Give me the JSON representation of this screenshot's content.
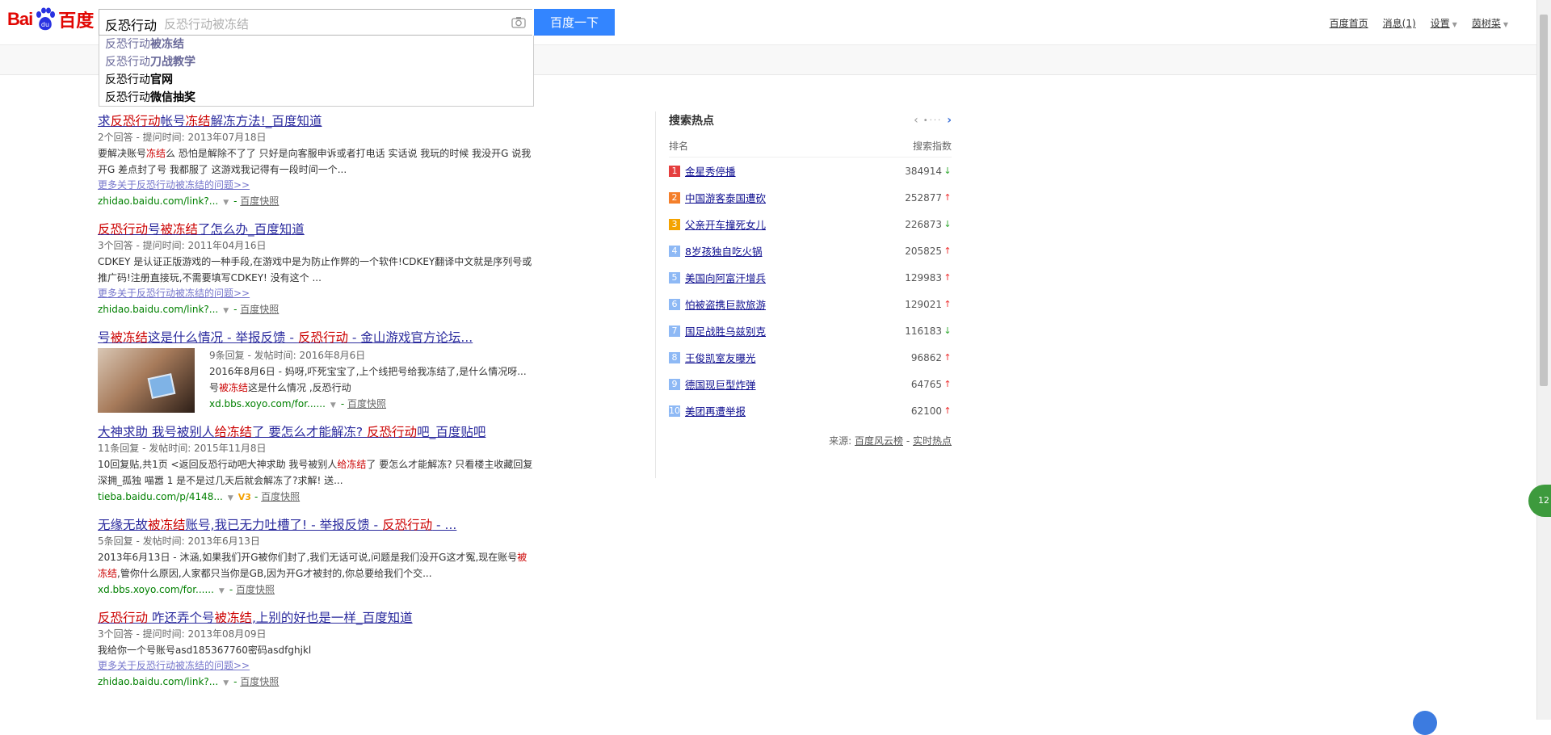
{
  "logo": {
    "bai": "Bai",
    "du": "百度"
  },
  "search": {
    "query": "反恐行动",
    "hint": "反恐行动被冻结",
    "button": "百度一下"
  },
  "suggestions": [
    {
      "prefix": "反恐行动",
      "suffix": "被冻结",
      "muted": true
    },
    {
      "prefix": "反恐行动",
      "suffix": "刀战教学",
      "muted": true
    },
    {
      "prefix": "反恐行动",
      "suffix": "官网",
      "muted": false
    },
    {
      "prefix": "反恐行动",
      "suffix": "微信抽奖",
      "muted": false
    }
  ],
  "nav": {
    "home": "百度首页",
    "messages": "消息(1)",
    "settings": "设置",
    "user": "茵树菜"
  },
  "results": [
    {
      "t": [
        "求",
        "反恐行动",
        "帐号",
        "冻结",
        "解冻方法!_百度知道"
      ],
      "meta": "2个回答 - 提问时间: 2013年07月18日",
      "abs1": "要解决账号",
      "absem": "冻结",
      "abs2": "么 恐怕是解除不了了 只好是向客服申诉或者打电话 实话说 我玩的时候 我没开G 说我开G 差点封了号 我都服了 这游戏我记得有一段时间一个...",
      "more": "更多关于反恐行动被冻结的问题>>",
      "url": "zhidao.baidu.com/link?...",
      "snap": "百度快照"
    },
    {
      "t": [
        "",
        "反恐行动",
        "号",
        "被冻结",
        "了怎么办_百度知道"
      ],
      "meta": "3个回答 - 提问时间: 2011年04月16日",
      "abs1": "CDKEY 是认证正版游戏的一种手段,在游戏中是为防止作弊的一个软件!CDKEY翻译中文就是序列号或推广码!注册直接玩,不需要填写CDKEY! 没有这个 ...",
      "absem": "",
      "abs2": "",
      "more": "更多关于反恐行动被冻结的问题>>",
      "url": "zhidao.baidu.com/link?...",
      "snap": "百度快照"
    },
    {
      "t": [
        "号",
        "被冻结",
        "这是什么情况 - 举报反馈 - ",
        "反恐行动",
        " - 金山游戏官方论坛..."
      ],
      "meta": "9条回复 - 发帖时间: 2016年8月6日",
      "abs1": "2016年8月6日 - 妈呀,吓死宝宝了,上个线把号给我冻结了,是什么情况呀... 号",
      "absem": "被冻结",
      "abs2": "这是什么情况 ,反恐行动",
      "more": "",
      "url": "xd.bbs.xoyo.com/for......",
      "snap": "百度快照"
    },
    {
      "t": [
        "大神求助 我号被别人",
        "给冻结",
        "了 要怎么才能解冻? ",
        "反恐行动",
        "吧_百度贴吧"
      ],
      "meta": "11条回复 - 发帖时间: 2015年11月8日",
      "abs1": "10回复贴,共1页 <返回反恐行动吧大神求助 我号被别人",
      "absem": "给冻结",
      "abs2": "了 要怎么才能解冻? 只看楼主收藏回复 深拥_孤独 喵嚣 1 是不是过几天后就会解冻了?求解! 送...",
      "more": "",
      "url": "tieba.baidu.com/p/4148...",
      "v3": "V3",
      "snap": "百度快照"
    },
    {
      "t": [
        "无缘无故",
        "被冻结",
        "账号,我已无力吐槽了! - 举报反馈 - ",
        "反恐行动",
        " - ..."
      ],
      "meta": "5条回复 - 发帖时间: 2013年6月13日",
      "abs1": "2013年6月13日 - 沐涵,如果我们开G被你们封了,我们无话可说,问题是我们没开G这才冤,现在账号",
      "absem": "被冻结",
      "abs2": ",管你什么原因,人家都只当你是GB,因为开G才被封的,你总要给我们个交...",
      "more": "",
      "url": "xd.bbs.xoyo.com/for......",
      "snap": "百度快照"
    },
    {
      "t": [
        "",
        "反恐行动",
        " 咋还弄个号",
        "被冻结",
        ",上别的好也是一样_百度知道"
      ],
      "meta": "3个回答 - 提问时间: 2013年08月09日",
      "abs1": "我给你一个号账号asd185367760密码asdfghjkl",
      "absem": "",
      "abs2": "",
      "more": "更多关于反恐行动被冻结的问题>>",
      "url": "zhidao.baidu.com/link?...",
      "snap": "百度快照"
    }
  ],
  "hot": {
    "title": "搜索热点",
    "col_rank": "排名",
    "col_index": "搜索指数",
    "source_label": "来源:",
    "source_1": "百度风云榜",
    "source_sep": "-",
    "source_2": "实时热点",
    "rows": [
      {
        "rank": "1",
        "name": "金星秀停播",
        "val": "384914",
        "dir": "down",
        "color": "#e53e3e"
      },
      {
        "rank": "2",
        "name": "中国游客泰国遭砍",
        "val": "252877",
        "dir": "up",
        "color": "#f47f2b"
      },
      {
        "rank": "3",
        "name": "父亲开车撞死女儿",
        "val": "226873",
        "dir": "down",
        "color": "#f4a300"
      },
      {
        "rank": "4",
        "name": "8岁孩独自吃火锅",
        "val": "205825",
        "dir": "up",
        "color": "#8eb9f5"
      },
      {
        "rank": "5",
        "name": "美国向阿富汗增兵",
        "val": "129983",
        "dir": "up",
        "color": "#8eb9f5"
      },
      {
        "rank": "6",
        "name": "怕被盗携巨款旅游",
        "val": "129021",
        "dir": "up",
        "color": "#8eb9f5"
      },
      {
        "rank": "7",
        "name": "国足战胜乌兹别克",
        "val": "116183",
        "dir": "down",
        "color": "#8eb9f5"
      },
      {
        "rank": "8",
        "name": "王俊凯室友曝光",
        "val": "96862",
        "dir": "up",
        "color": "#8eb9f5"
      },
      {
        "rank": "9",
        "name": "德国现巨型炸弹",
        "val": "64765",
        "dir": "up",
        "color": "#8eb9f5"
      },
      {
        "rank": "10",
        "name": "美团再遭举报",
        "val": "62100",
        "dir": "up",
        "color": "#8eb9f5"
      }
    ]
  },
  "side_badge": "12",
  "colors": {
    "brand_red": "#e10602",
    "button_blue": "#3385ff",
    "link": "#2b2b9e",
    "keyword": "#cc0000",
    "url_green": "#008000"
  }
}
